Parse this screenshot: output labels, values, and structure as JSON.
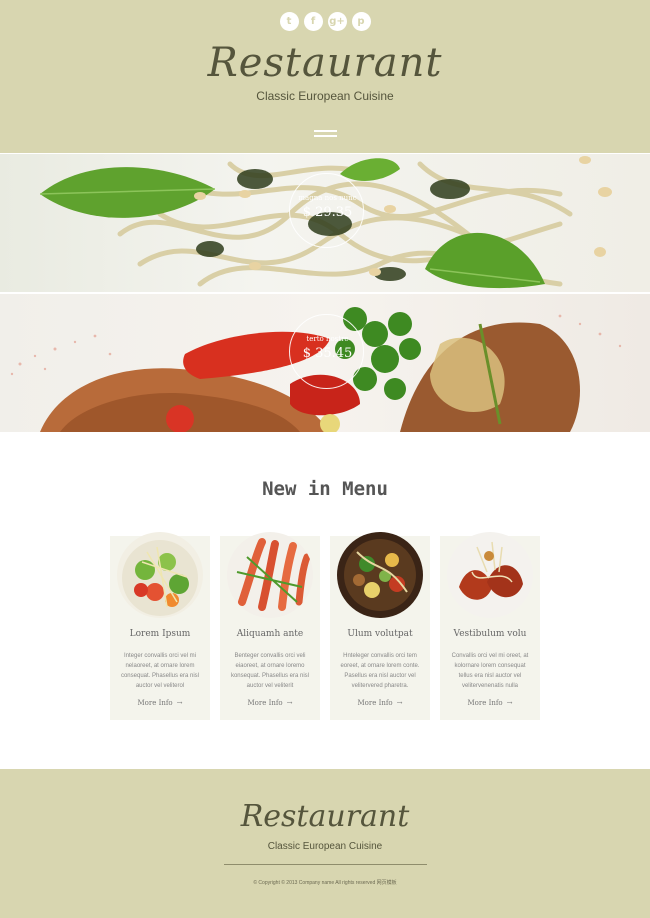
{
  "header": {
    "social_icons": [
      {
        "name": "twitter-icon",
        "glyph": "t"
      },
      {
        "name": "facebook-icon",
        "glyph": "f"
      },
      {
        "name": "google-plus-icon",
        "glyph": "g+"
      },
      {
        "name": "pinterest-icon",
        "glyph": "p"
      }
    ],
    "brand": "Restaurant",
    "tagline": "Classic European Cuisine",
    "menu_icon": "hamburger-icon"
  },
  "banners": [
    {
      "name": "magna nos nunc",
      "price": "$ 29.35"
    },
    {
      "name": "terto nostre",
      "price": "$ 35.45"
    }
  ],
  "menu_section": {
    "title": "New in Menu",
    "cards": [
      {
        "title": "Lorem Ipsum",
        "text": "Integer convallis orci vel mi nelaoreet, at ornare lorem consequat. Phasellus era nisl auctor vel veliterol",
        "more": "More Info"
      },
      {
        "title": "Aliquamh ante",
        "text": "Benteger convallis orci veli eiaoreet, at ornare loremo konsequat. Phasellus era nisl auctor vel veliterit",
        "more": "More Info"
      },
      {
        "title": "Ulum volutpat",
        "text": "Hnteleger convallis orci tem eoreet, at ornare lorem conte. Pasellus era nisl auctor vel velitervered pharetra.",
        "more": "More Info"
      },
      {
        "title": "Vestibulum volu",
        "text": "Convallis orci vel mi oreet, at kolornare lorem consequat tellus era nisl auctor vel velitervenenatis nulla",
        "more": "More Info"
      }
    ]
  },
  "footer": {
    "brand": "Restaurant",
    "tagline": "Classic European Cuisine",
    "copyright": "© Copyright © 2013 Company name All rights reserved 网页模板"
  },
  "colors": {
    "header_bg": "#d8d6b0",
    "brand_text": "#55553c",
    "card_bg": "#f4f4ec"
  }
}
